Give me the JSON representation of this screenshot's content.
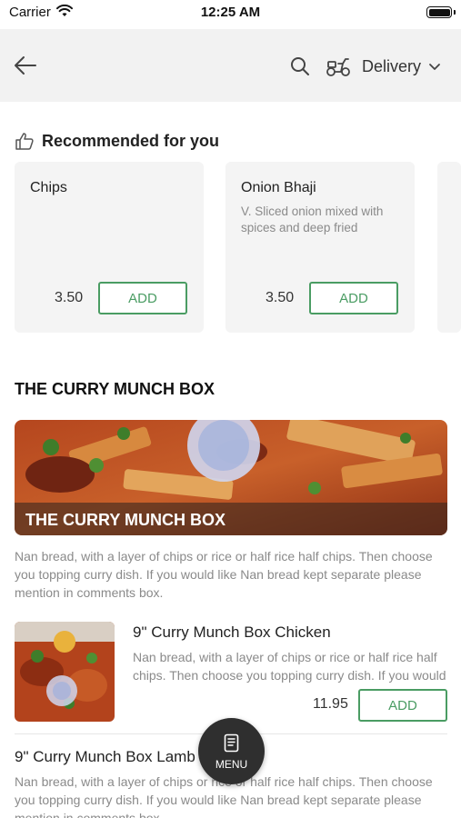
{
  "status_bar": {
    "carrier": "Carrier",
    "time": "12:25 AM"
  },
  "nav": {
    "back_icon": "arrow-left-icon",
    "search_icon": "search-icon",
    "delivery_icon": "scooter-icon",
    "delivery_label": "Delivery",
    "dropdown_icon": "chevron-down-icon"
  },
  "recommended": {
    "title": "Recommended for you",
    "icon": "thumbs-up-icon",
    "items": [
      {
        "name": "Chips",
        "description": "",
        "price": "3.50",
        "add_label": "ADD"
      },
      {
        "name": "Onion Bhaji",
        "description": "V. Sliced onion mixed with spices and deep fried",
        "price": "3.50",
        "add_label": "ADD"
      }
    ]
  },
  "section": {
    "title": "THE CURRY MUNCH BOX",
    "banner_label": "THE CURRY MUNCH BOX",
    "description": "Nan bread, with a layer of chips or rice or half rice half chips. Then choose you topping curry dish. If you would like Nan bread kept separate please mention in comments box."
  },
  "items": [
    {
      "name": "9\" Curry Munch Box Chicken",
      "description": "Nan bread, with a layer of chips or rice or half rice half chips. Then choose you topping curry dish. If you would like Nan bread kept separate please mention in comments box.",
      "price": "11.95",
      "add_label": "ADD"
    },
    {
      "name": "9\" Curry Munch Box Lamb",
      "description": "Nan bread, with a layer of chips or rice or half rice half chips. Then choose you topping curry dish. If you would like Nan bread kept separate please mention in comments box."
    }
  ],
  "menu_button": {
    "label": "MENU",
    "icon": "menu-book-icon"
  },
  "colors": {
    "accent": "#4a9c63",
    "nav_bg": "#f2f2f2",
    "card_bg": "#f4f4f4",
    "fab_bg": "#2f2f2f"
  }
}
